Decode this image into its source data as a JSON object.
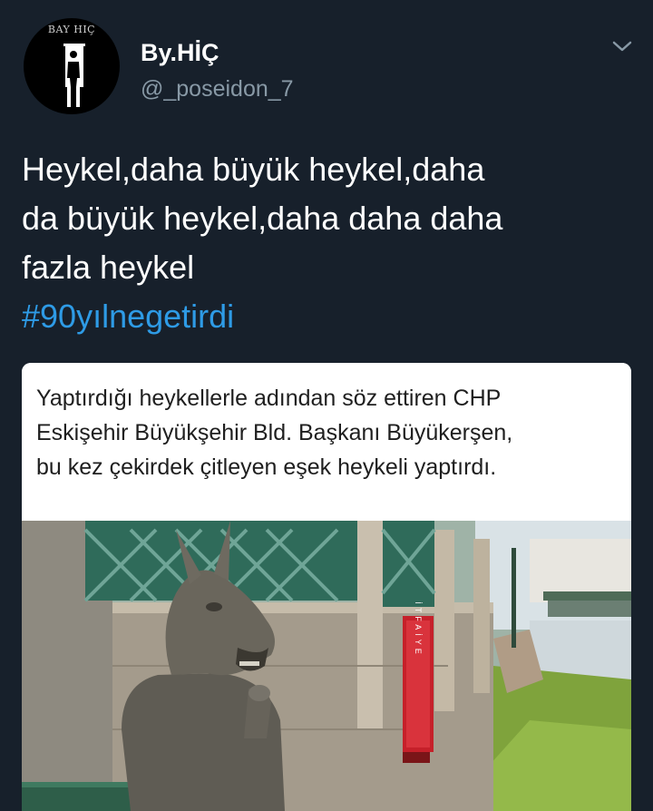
{
  "author": {
    "avatar_text": "BAY HIÇ",
    "display_name": "By.HİÇ",
    "handle": "@_poseidon_7"
  },
  "menu": {
    "icon": "chevron-down-icon"
  },
  "tweet": {
    "lines": [
      "Heykel,daha büyük heykel,daha",
      "da büyük heykel,daha daha daha",
      "fazla heykel"
    ],
    "hashtag": "#90yılnegetirdi"
  },
  "media": {
    "caption_lines": [
      "Yaptırdığı heykellerle adından söz ettiren CHP",
      "Eskişehir Büyükşehir Bld. Başkanı Büyükerşen,",
      "bu kez çekirdek çitleyen eşek heykeli yaptırdı."
    ],
    "cabinet_text": "İTFAİYE"
  },
  "colors": {
    "background": "#17202b",
    "hashtag": "#2e9be6",
    "handle": "#8899a6"
  }
}
